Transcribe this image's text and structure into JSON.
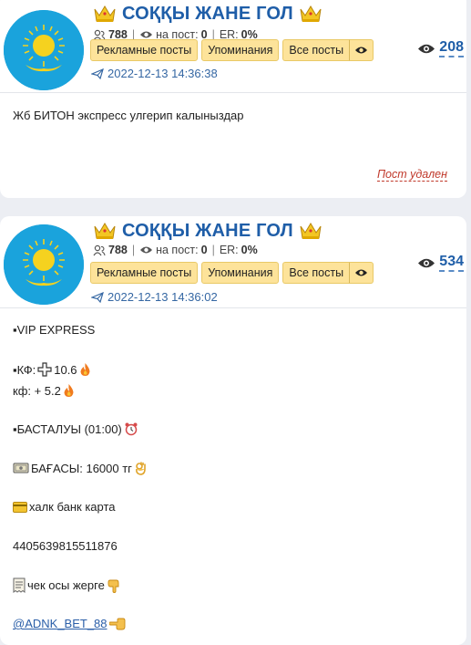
{
  "channel_name": "СОҚҚЫ ЖАНЕ ГОЛ",
  "icons": {
    "crown": "crown-icon",
    "subscribers": "people-icon",
    "views": "eye-icon",
    "date": "paper-plane-icon"
  },
  "colors": {
    "title": "#1f5ea8",
    "button_bg": "#fde39a",
    "deleted": "#c0392b",
    "page_bg": "#eceef3"
  },
  "posts": [
    {
      "subscribers": "788",
      "per_post_label": "на пост:",
      "per_post": "0",
      "er_label": "ER:",
      "er": "0%",
      "buttons": {
        "ads": "Рекламные посты",
        "mentions": "Упоминания",
        "all": "Все посты"
      },
      "date": "2022-12-13 14:36:38",
      "views": "208",
      "text": "Жб БИТОН экспресс улгерип калыныздар",
      "status": "Пост удален"
    },
    {
      "subscribers": "788",
      "per_post_label": "на пост:",
      "per_post": "0",
      "er_label": "ER:",
      "er": "0%",
      "buttons": {
        "ads": "Рекламные посты",
        "mentions": "Упоминания",
        "all": "Все посты"
      },
      "date": "2022-12-13 14:36:02",
      "views": "534",
      "lines": {
        "vip": "▪VIP EXPRESS",
        "kf1": "▪КФ:",
        "kf1_value": " 10.6",
        "kf2": "кф: + 5.2",
        "start": "▪БАСТАЛУЫ (01:00)",
        "price": "БАҒАСЫ: 16000 тг",
        "bank": " халк банк карта",
        "card_number": "4405639815511876",
        "check": "чек осы жерге",
        "handle": "@ADNK_BET_88"
      }
    }
  ]
}
